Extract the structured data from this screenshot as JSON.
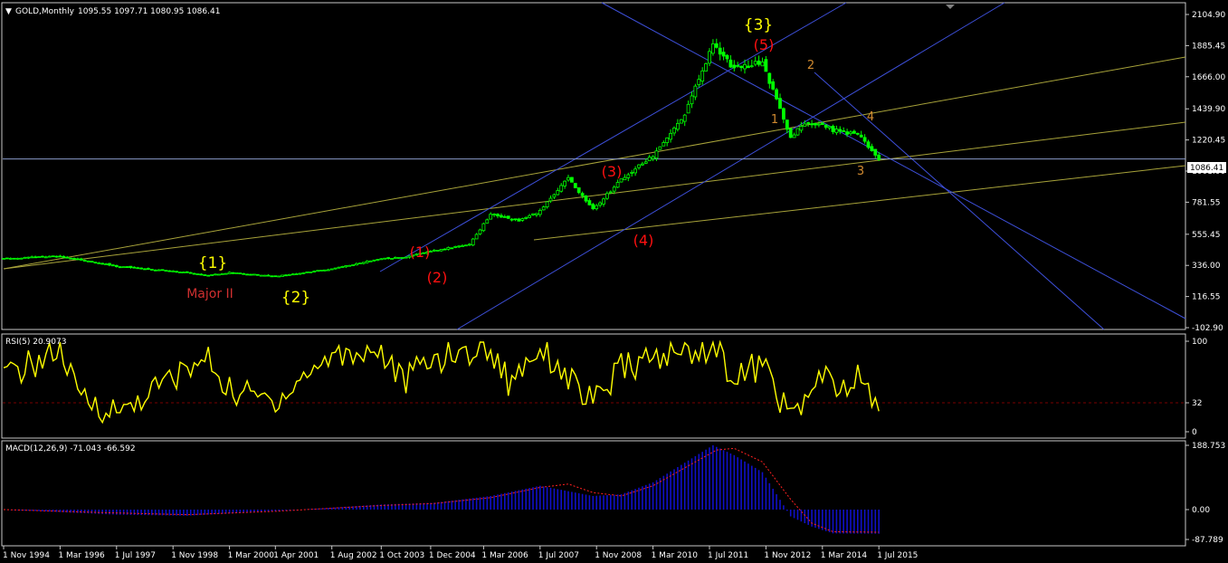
{
  "header": {
    "symbol": "GOLD,Monthly",
    "ohlc": "1095.55 1097.71 1080.95 1086.41",
    "arrow_glyph": "▼"
  },
  "colors": {
    "background": "#000000",
    "frame": "#c8c8c8",
    "candle": "#00ff00",
    "channel": "#3d4fd8",
    "fan": "#a8a33a",
    "price_line": "#8a9ac8",
    "rsi": "#ffff00",
    "rsi_level": "#7a0000",
    "macd_hist": "#1010c8",
    "macd_signal": "#ff2020",
    "wave_red": "#ff1010",
    "wave_yellow": "#ffff00",
    "wave_orange": "#d08a30",
    "major_label": "#d03030"
  },
  "price_axis": {
    "ticks": [
      "2104.90",
      "1885.45",
      "1666.00",
      "1439.90",
      "1220.45",
      "1001.00",
      "781.55",
      "555.45",
      "336.00",
      "116.55",
      "-102.90"
    ],
    "current_label": "1086.41"
  },
  "time_axis": {
    "ticks": [
      "1 Nov 1994",
      "1 Mar 1996",
      "1 Jul 1997",
      "1 Nov 1998",
      "1 Mar 2000",
      "1 Apr 2001",
      "1 Aug 2002",
      "1 Oct 2003",
      "1 Dec 2004",
      "1 Mar 2006",
      "1 Jul 2007",
      "1 Nov 2008",
      "1 Mar 2010",
      "1 Jul 2011",
      "1 Nov 2012",
      "1 Mar 2014",
      "1 Jul 2015"
    ]
  },
  "wave_labels": {
    "major_1": "{1}",
    "major_2": "{2}",
    "major_3": "{3}",
    "major_ii": "Major II",
    "inter_1": "(1)",
    "inter_2": "(2)",
    "inter_3": "(3)",
    "inter_4": "(4)",
    "inter_5": "(5)",
    "minor_1": "1",
    "minor_2": "2",
    "minor_3": "3",
    "minor_4": "4"
  },
  "rsi": {
    "title": "RSI(5) 20.9073",
    "ticks": [
      "100",
      "32",
      "0"
    ],
    "level": 32
  },
  "macd": {
    "title": "MACD(12,26,9) -71.043 -66.592",
    "ticks": [
      "188.753",
      "0.00",
      "-87.789"
    ]
  },
  "chart_data": {
    "type": "candlestick",
    "title": "GOLD,Monthly",
    "ylim": [
      -102.9,
      2104.9
    ],
    "grid": false,
    "price_keypoints": [
      [
        "1994-11",
        384
      ],
      [
        "1996-03",
        400
      ],
      [
        "1997-07",
        330
      ],
      [
        "1998-11",
        295
      ],
      [
        "1999-09",
        265
      ],
      [
        "2000-03",
        285
      ],
      [
        "2001-04",
        260
      ],
      [
        "2002-08",
        310
      ],
      [
        "2003-10",
        385
      ],
      [
        "2004-04",
        390
      ],
      [
        "2004-12",
        440
      ],
      [
        "2005-11",
        480
      ],
      [
        "2006-05",
        700
      ],
      [
        "2007-01",
        650
      ],
      [
        "2007-07",
        720
      ],
      [
        "2008-03",
        950
      ],
      [
        "2008-10",
        730
      ],
      [
        "2009-06",
        940
      ],
      [
        "2010-03",
        1110
      ],
      [
        "2010-12",
        1400
      ],
      [
        "2011-08",
        1890
      ],
      [
        "2012-02",
        1720
      ],
      [
        "2012-10",
        1770
      ],
      [
        "2013-06",
        1230
      ],
      [
        "2013-09",
        1330
      ],
      [
        "2014-03",
        1330
      ],
      [
        "2014-06",
        1290
      ],
      [
        "2015-01",
        1260
      ],
      [
        "2015-07",
        1086
      ]
    ],
    "rsi_keypoints": [
      [
        "1994-11",
        60
      ],
      [
        "1996-03",
        90
      ],
      [
        "1996-08",
        40
      ],
      [
        "1997-07",
        20
      ],
      [
        "1998-11",
        60
      ],
      [
        "1999-09",
        80
      ],
      [
        "2000-03",
        45
      ],
      [
        "2001-04",
        35
      ],
      [
        "2002-08",
        85
      ],
      [
        "2003-10",
        90
      ],
      [
        "2004-04",
        55
      ],
      [
        "2004-12",
        80
      ],
      [
        "2006-05",
        92
      ],
      [
        "2006-10",
        55
      ],
      [
        "2007-07",
        95
      ],
      [
        "2008-10",
        30
      ],
      [
        "2009-06",
        70
      ],
      [
        "2010-03",
        80
      ],
      [
        "2011-08",
        95
      ],
      [
        "2012-02",
        60
      ],
      [
        "2012-10",
        75
      ],
      [
        "2013-06",
        15
      ],
      [
        "2014-03",
        60
      ],
      [
        "2014-10",
        40
      ],
      [
        "2015-01",
        65
      ],
      [
        "2015-07",
        21
      ]
    ],
    "macd_keypoints": [
      [
        "1994-11",
        0
      ],
      [
        "1997-07",
        -15
      ],
      [
        "1999-03",
        -18
      ],
      [
        "2001-04",
        -5
      ],
      [
        "2003-10",
        15
      ],
      [
        "2005-01",
        20
      ],
      [
        "2006-05",
        40
      ],
      [
        "2007-07",
        70
      ],
      [
        "2008-10",
        40
      ],
      [
        "2009-06",
        45
      ],
      [
        "2010-03",
        80
      ],
      [
        "2011-08",
        189
      ],
      [
        "2012-02",
        160
      ],
      [
        "2012-10",
        110
      ],
      [
        "2013-06",
        -20
      ],
      [
        "2013-12",
        -50
      ],
      [
        "2014-06",
        -70
      ],
      [
        "2015-07",
        -71
      ]
    ],
    "signal_keypoints": [
      [
        "1994-11",
        0
      ],
      [
        "1997-07",
        -10
      ],
      [
        "1999-03",
        -15
      ],
      [
        "2001-04",
        -5
      ],
      [
        "2003-10",
        12
      ],
      [
        "2005-01",
        18
      ],
      [
        "2006-05",
        35
      ],
      [
        "2007-07",
        65
      ],
      [
        "2008-03",
        75
      ],
      [
        "2008-10",
        50
      ],
      [
        "2009-06",
        40
      ],
      [
        "2010-03",
        70
      ],
      [
        "2011-09",
        175
      ],
      [
        "2012-02",
        180
      ],
      [
        "2012-10",
        140
      ],
      [
        "2013-06",
        30
      ],
      [
        "2013-12",
        -40
      ],
      [
        "2014-06",
        -65
      ],
      [
        "2015-07",
        -66.592
      ]
    ]
  }
}
